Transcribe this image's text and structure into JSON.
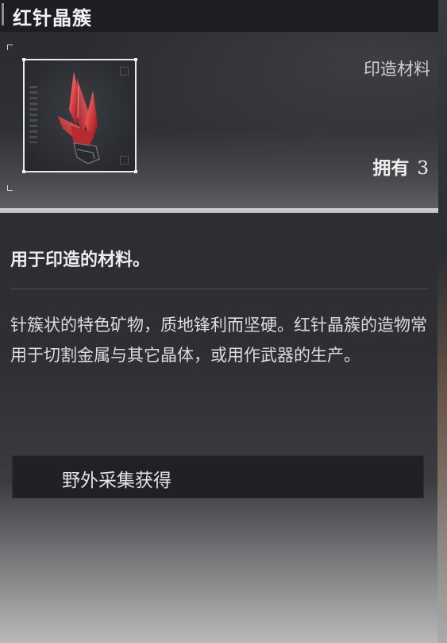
{
  "item": {
    "name": "红针晶簇",
    "category": "印造材料",
    "owned_label": "拥有",
    "owned_count": "3",
    "icon": "red-crystal-cluster-icon",
    "accent_color": "#d63a3f"
  },
  "summary": "用于印造的材料。",
  "description": "针簇状的特色矿物，质地锋利而坚硬。红针晶簇的造物常用于切割金属与其它晶体，或用作武器的生产。",
  "source": {
    "label": "野外采集获得"
  }
}
